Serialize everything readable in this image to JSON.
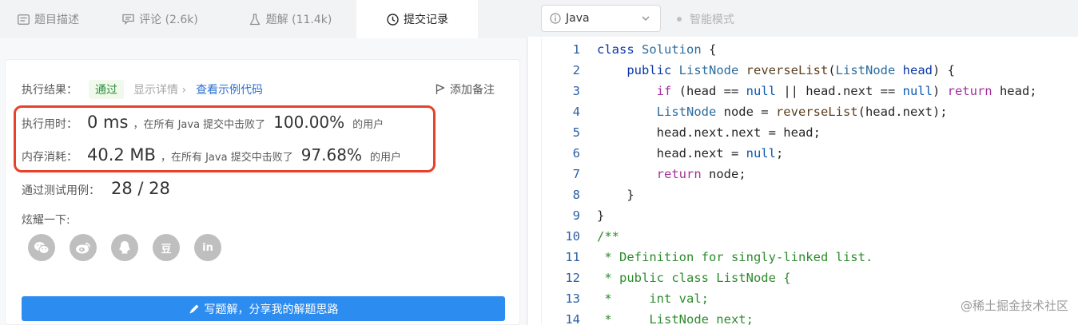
{
  "tabs": [
    {
      "label": "题目描述",
      "icon": "description-icon"
    },
    {
      "label": "评论 (2.6k)",
      "icon": "comment-icon"
    },
    {
      "label": "题解 (11.4k)",
      "icon": "flask-icon"
    },
    {
      "label": "提交记录",
      "icon": "clock-icon"
    }
  ],
  "result": {
    "label": "执行结果：",
    "status": "通过",
    "detail": "显示详情 ›",
    "example": "查看示例代码",
    "note": "添加备注"
  },
  "runtime": {
    "label": "执行用时：",
    "value": "0 ms",
    "text": "，在所有 Java 提交中击败了",
    "percent": "100.00%",
    "suffix": "的用户"
  },
  "memory": {
    "label": "内存消耗：",
    "value": "40.2 MB",
    "text": "，在所有 Java 提交中击败了",
    "percent": "97.68%",
    "suffix": "的用户"
  },
  "tests": {
    "label": "通过测试用例：",
    "value": "28 / 28"
  },
  "share": {
    "label": "炫耀一下:",
    "items": [
      "wechat-icon",
      "weibo-icon",
      "qq-icon",
      "douban-icon",
      "linkedin-icon"
    ],
    "douban": "豆",
    "linkedin": "in"
  },
  "write_button": "写题解，分享我的解题思路",
  "editor": {
    "language": "Java",
    "smart_mode": "智能模式",
    "line_numbers": [
      "1",
      "2",
      "3",
      "4",
      "5",
      "6",
      "7",
      "8",
      "9",
      "10",
      "11",
      "12",
      "13",
      "14"
    ]
  },
  "watermark": "@稀土掘金技术社区",
  "colors": {
    "accent": "#2d8cf0",
    "highlight_border": "#e8412b",
    "pass": "#2d8f3d"
  }
}
